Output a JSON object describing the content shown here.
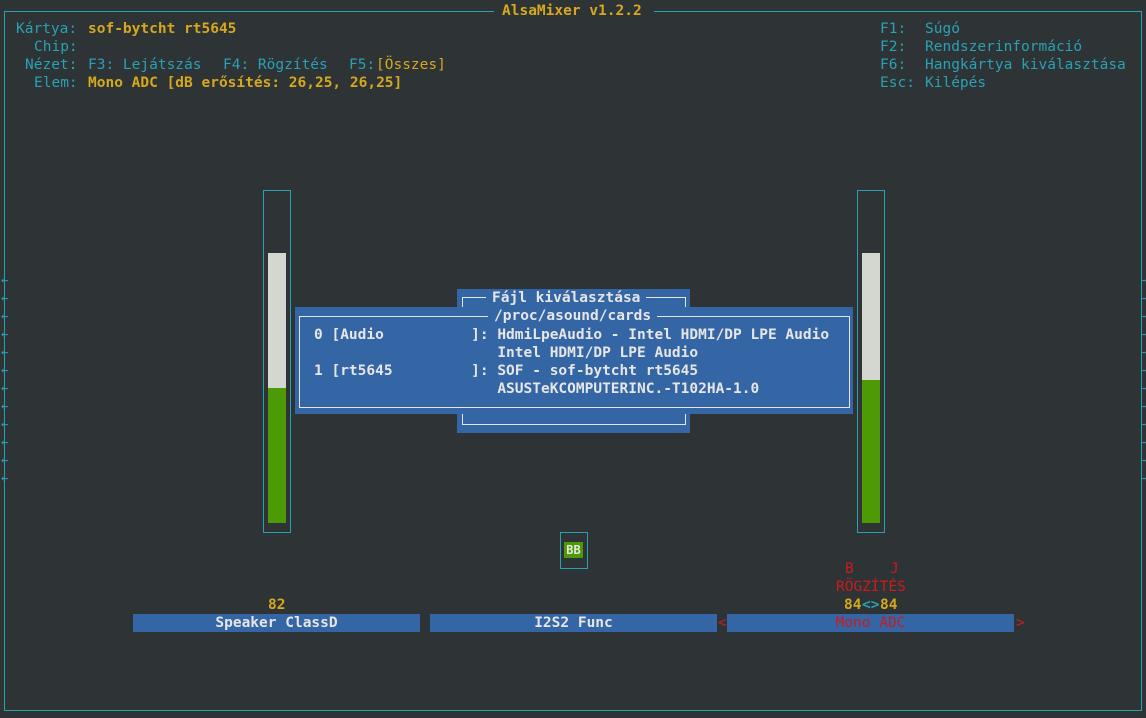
{
  "window": {
    "title": "AlsaMixer v1.2.2"
  },
  "header": {
    "card_label": "Kártya:",
    "card_value": "sof-bytcht rt5645",
    "chip_label": "Chip:",
    "view_label": "Nézet:",
    "view_f3": "F3: Lejátszás",
    "view_f4": "F4: Rögzítés",
    "view_f5_key": "F5:",
    "view_f5_value": "[Összes]",
    "element_label": "Elem:",
    "element_value": "Mono ADC [dB erősítés: 26,25, 26,25]"
  },
  "help": {
    "f1_key": "F1:",
    "f1_label": "Súgó",
    "f2_key": "F2:",
    "f2_label": "Rendszerinformáció",
    "f6_key": "F6:",
    "f6_label": "Hangkártya kiválasztása",
    "esc_key": "Esc:",
    "esc_label": "Kilépés"
  },
  "dialog": {
    "title": "Fájl kiválasztása",
    "path": "/proc/asound/cards",
    "rows": [
      "0 [Audio          ]: HdmiLpeAudio - Intel HDMI/DP LPE Audio",
      "                     Intel HDMI/DP LPE Audio",
      "1 [rt5645         ]: SOF - sof-bytcht rt5645",
      "                     ASUSTeKCOMPUTERINC.-T102HA-1.0"
    ]
  },
  "switch": {
    "label": "BB"
  },
  "capture": {
    "left_flag": "B",
    "right_flag": "J",
    "label": "RÖGZÍTÉS",
    "left_value": "84",
    "separator": "<>",
    "right_value": "84"
  },
  "channels": [
    {
      "name": "Speaker ClassD",
      "value": "82",
      "level": 0.5
    },
    {
      "name": "I2S2 Func"
    },
    {
      "name": "Mono ADC",
      "level": 0.53,
      "selected": true
    }
  ],
  "scroll_arrows": {
    "left": "←",
    "right": "→"
  },
  "selection_markers": {
    "left": "<",
    "right": ">"
  },
  "colors": {
    "background": "#2e3436",
    "frame": "#2aa1b3",
    "highlight": "#d6a81d",
    "dialog": "#3465a4",
    "bar_green": "#4e9a06",
    "bar_empty": "#d3d7cf",
    "selected_text": "#cc1b1b"
  }
}
